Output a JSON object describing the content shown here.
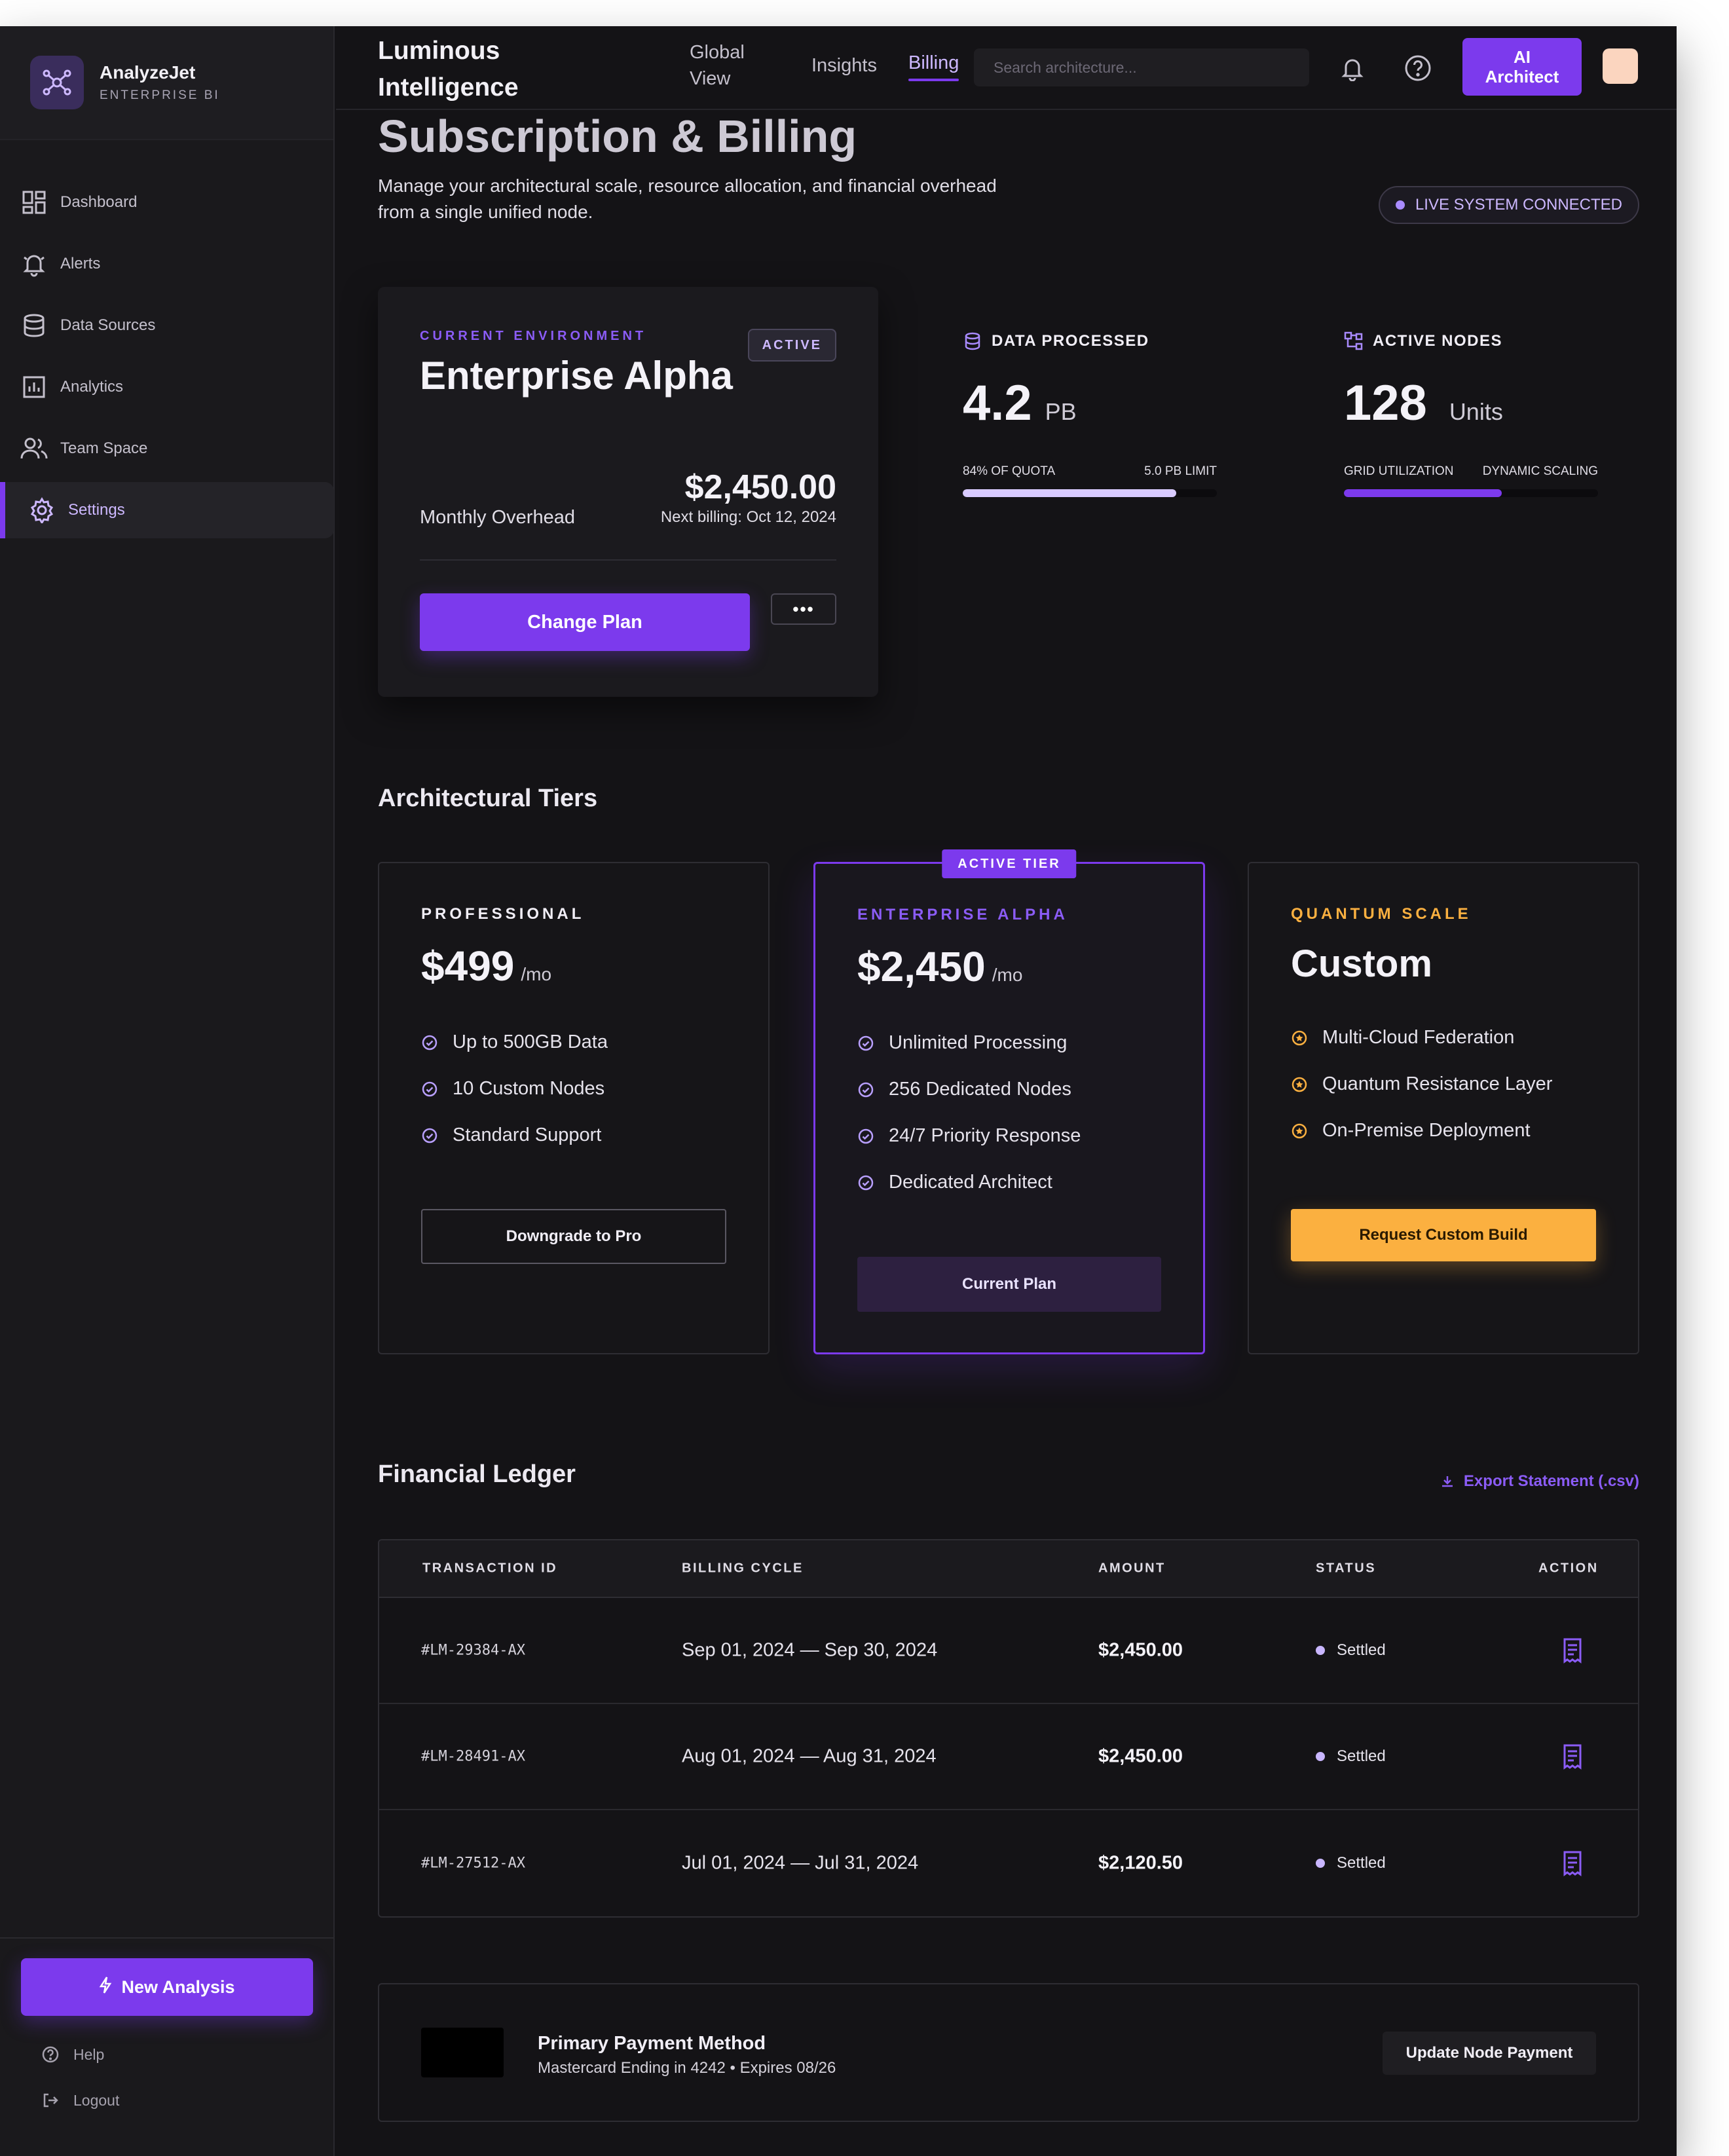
{
  "brand": {
    "name": "AnalyzeJet",
    "subtitle": "ENTERPRISE BI",
    "logo_icon": "network-icon"
  },
  "sidebar": {
    "items": [
      {
        "label": "Dashboard",
        "icon": "dashboard-icon"
      },
      {
        "label": "Alerts",
        "icon": "bell-icon"
      },
      {
        "label": "Data Sources",
        "icon": "database-icon"
      },
      {
        "label": "Analytics",
        "icon": "chart-icon"
      },
      {
        "label": "Team Space",
        "icon": "users-icon"
      },
      {
        "label": "Settings",
        "icon": "gear-icon",
        "active": true
      }
    ],
    "new_analysis": "New Analysis",
    "help": "Help",
    "logout": "Logout"
  },
  "topbar": {
    "title": "Luminous Intelligence",
    "tabs": [
      {
        "label": "Global View"
      },
      {
        "label": "Insights"
      },
      {
        "label": "Billing",
        "active": true
      }
    ],
    "search_placeholder": "Search architecture...",
    "ai_button": "AI Architect"
  },
  "page": {
    "title": "Subscription & Billing",
    "description": "Manage your architectural scale, resource allocation, and financial overhead from a single unified node.",
    "live_status": "LIVE SYSTEM CONNECTED"
  },
  "environment": {
    "overline": "CURRENT ENVIRONMENT",
    "name": "Enterprise Alpha",
    "badge": "ACTIVE",
    "overhead_label": "Monthly Overhead",
    "overhead_amount": "$2,450.00",
    "next_billing": "Next billing: Oct 12, 2024",
    "change_plan": "Change Plan",
    "more": "•••"
  },
  "stats": {
    "data_processed": {
      "label": "DATA PROCESSED",
      "value": "4.2",
      "unit": "PB",
      "meta_left": "84% OF QUOTA",
      "meta_right": "5.0 PB LIMIT",
      "fill": 0.84
    },
    "active_nodes": {
      "label": "ACTIVE NODES",
      "value": "128",
      "unit": "Units",
      "meta_left": "GRID UTILIZATION",
      "meta_right": "DYNAMIC SCALING",
      "fill": 0.62
    }
  },
  "tiers": {
    "section_title": "Architectural Tiers",
    "items": [
      {
        "name": "PROFESSIONAL",
        "price": "$499",
        "per": "/mo",
        "features": [
          "Up to 500GB Data",
          "10 Custom Nodes",
          "Standard Support"
        ],
        "button": "Downgrade to Pro"
      },
      {
        "badge": "ACTIVE TIER",
        "name": "ENTERPRISE ALPHA",
        "price": "$2,450",
        "per": "/mo",
        "features": [
          "Unlimited Processing",
          "256 Dedicated Nodes",
          "24/7 Priority Response",
          "Dedicated Architect"
        ],
        "button": "Current Plan"
      },
      {
        "name": "QUANTUM SCALE",
        "price": "Custom",
        "features": [
          "Multi-Cloud Federation",
          "Quantum Resistance Layer",
          "On-Premise Deployment"
        ],
        "button": "Request Custom Build"
      }
    ]
  },
  "ledger": {
    "section_title": "Financial Ledger",
    "export": "Export Statement (.csv)",
    "columns": [
      "TRANSACTION ID",
      "BILLING CYCLE",
      "AMOUNT",
      "STATUS",
      "ACTION"
    ],
    "rows": [
      {
        "id": "#LM-29384-AX",
        "cycle": "Sep 01, 2024 — Sep 30, 2024",
        "amount": "$2,450.00",
        "status": "Settled"
      },
      {
        "id": "#LM-28491-AX",
        "cycle": "Aug 01, 2024 — Aug 31, 2024",
        "amount": "$2,450.00",
        "status": "Settled"
      },
      {
        "id": "#LM-27512-AX",
        "cycle": "Jul 01, 2024 — Jul 31, 2024",
        "amount": "$2,120.50",
        "status": "Settled"
      }
    ]
  },
  "payment": {
    "title": "Primary Payment Method",
    "detail": "Mastercard Ending in 4242 • Expires 08/26",
    "button": "Update Node Payment"
  },
  "colors": {
    "accent": "#7c3aed",
    "accent_light": "#cdb8ff",
    "gold": "#fbb040",
    "background": "#141316"
  }
}
